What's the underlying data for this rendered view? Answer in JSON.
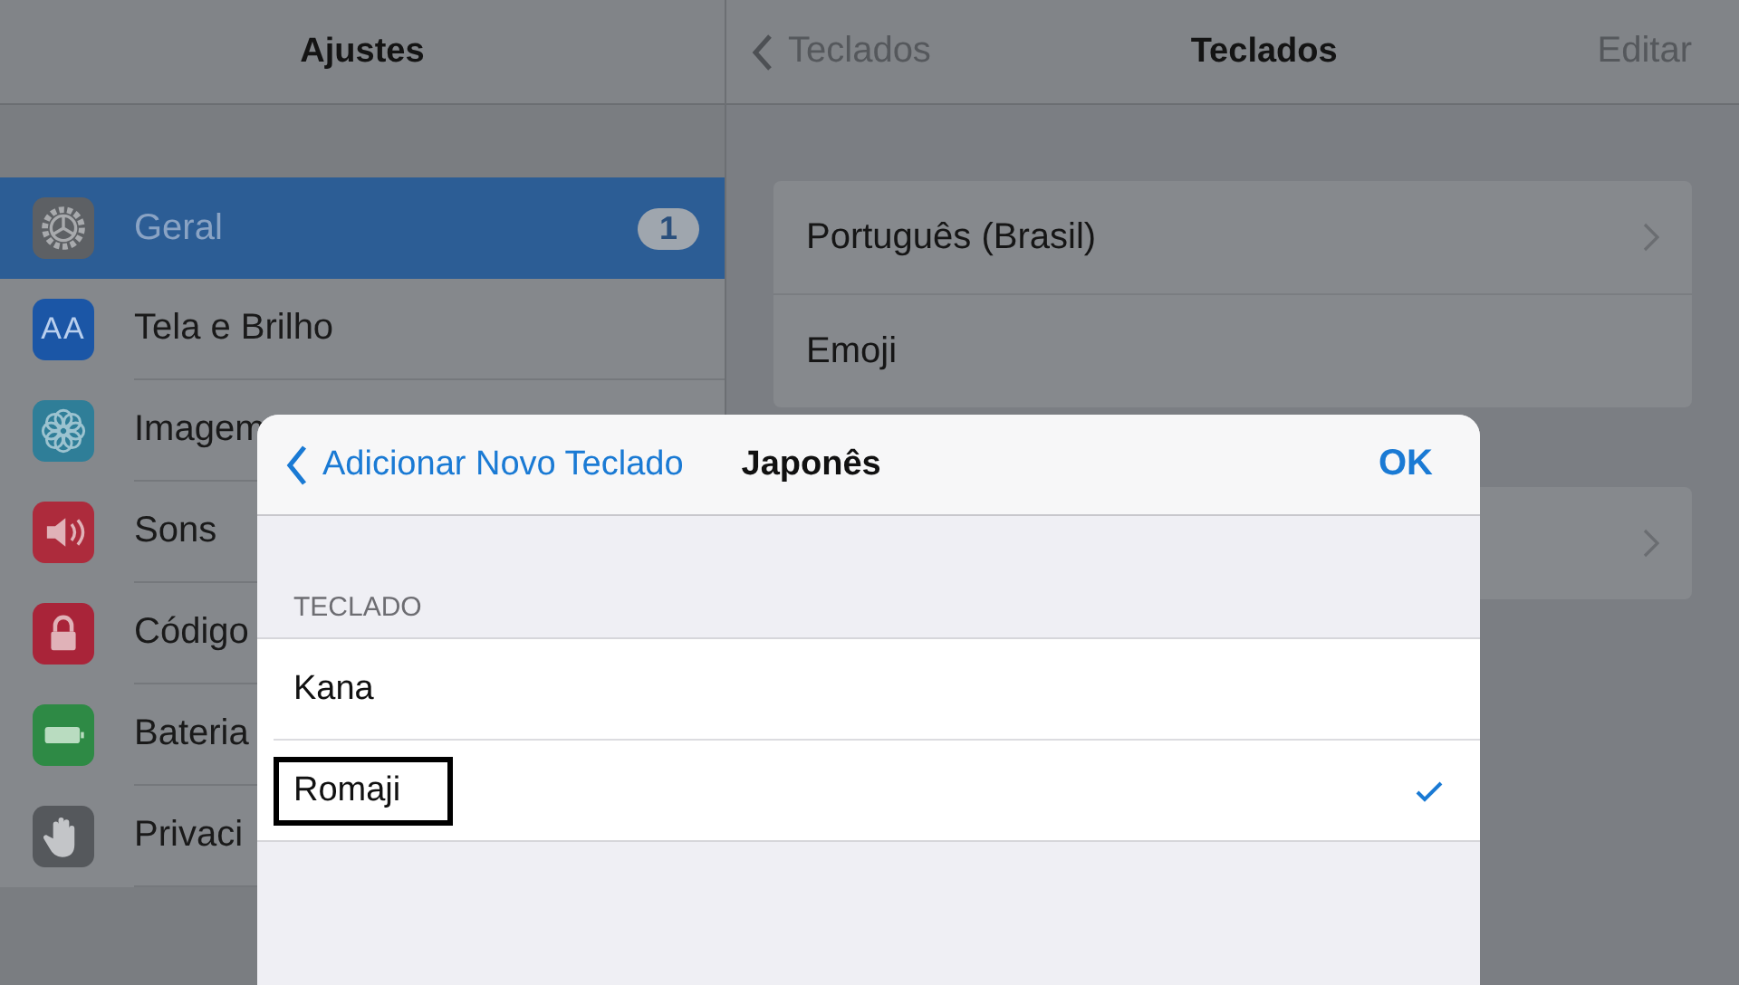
{
  "sidebar": {
    "title": "Ajustes",
    "items": [
      {
        "label": "Geral",
        "kind": "gear",
        "selected": true,
        "badge": "1"
      },
      {
        "label": "Tela e Brilho",
        "kind": "text-size",
        "icon_text": "AA",
        "selected": false
      },
      {
        "label": "Imagem",
        "kind": "flower",
        "selected": false
      },
      {
        "label": "Sons",
        "kind": "speaker",
        "selected": false
      },
      {
        "label": "Código",
        "kind": "lock",
        "selected": false
      },
      {
        "label": "Bateria",
        "kind": "battery",
        "selected": false
      },
      {
        "label": "Privaci",
        "kind": "hand",
        "selected": false
      }
    ]
  },
  "detail": {
    "back": "Teclados",
    "title": "Teclados",
    "action": "Editar",
    "groups": [
      {
        "rows": [
          {
            "label": "Português (Brasil)",
            "chevron": true
          },
          {
            "label": "Emoji",
            "chevron": false
          }
        ]
      },
      {
        "rows": [
          {
            "chevron": true
          }
        ]
      }
    ]
  },
  "modal": {
    "back": "Adicionar Novo Teclado",
    "title": "Japonês",
    "done": "OK",
    "section": "TECLADO",
    "options": [
      {
        "label": "Kana",
        "selected": false,
        "highlighted": false
      },
      {
        "label": "Romaji",
        "selected": true,
        "highlighted": true
      }
    ]
  }
}
